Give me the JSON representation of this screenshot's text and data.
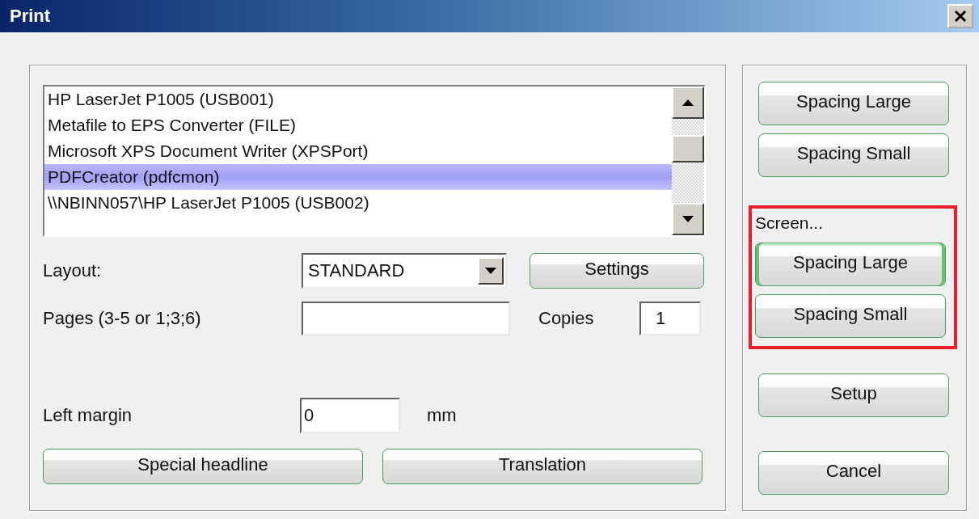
{
  "window": {
    "title": "Print"
  },
  "printers": {
    "items": [
      {
        "label": "HP LaserJet P1005 (USB001)",
        "selected": false
      },
      {
        "label": "Metafile to EPS Converter (FILE)",
        "selected": false
      },
      {
        "label": "Microsoft XPS Document Writer (XPSPort)",
        "selected": false
      },
      {
        "label": "PDFCreator (pdfcmon)",
        "selected": true
      },
      {
        "label": "\\\\NBINN057\\HP LaserJet P1005 (USB002)",
        "selected": false
      }
    ]
  },
  "layout": {
    "label": "Layout:",
    "value": "STANDARD"
  },
  "settings_button": {
    "label": "Settings",
    "focused": false
  },
  "pages": {
    "label": "Pages (3-5 or 1;3;6)"
  },
  "copies": {
    "label": "Copies",
    "value": "1"
  },
  "left_margin": {
    "label": "Left margin",
    "value": "0",
    "unit": "mm"
  },
  "bottom_buttons": [
    {
      "label": "Special headline",
      "focused": false
    },
    {
      "label": "Translation",
      "focused": false
    }
  ],
  "side_buttons": [
    {
      "label": "Spacing Large",
      "focused": false
    },
    {
      "label": "Spacing Small",
      "focused": false
    }
  ],
  "screen_group": {
    "label": "Screen...",
    "highlighted": true,
    "buttons": [
      {
        "label": "Spacing Large",
        "focused": true
      },
      {
        "label": "Spacing Small",
        "focused": false
      }
    ]
  },
  "setup_button": {
    "label": "Setup",
    "focused": false
  },
  "cancel_button": {
    "label": "Cancel",
    "focused": false
  }
}
